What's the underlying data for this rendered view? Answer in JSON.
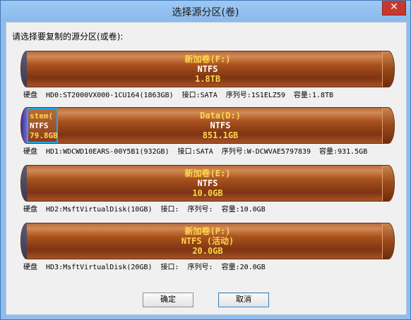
{
  "window": {
    "title": "选择源分区(卷)",
    "close_symbol": "✕"
  },
  "prompt": "请选择要复制的源分区(或卷):",
  "disks": [
    {
      "label": "硬盘",
      "id": "HD0:ST2000VX000-1CU164(1863GB)",
      "interface": "接口:SATA",
      "serial": "序列号:1S1ELZ59",
      "capacity": "容量:1.8TB",
      "partitions": [
        {
          "name": "新加卷(F:)",
          "fs": "NTFS",
          "size": "1.8TB"
        }
      ]
    },
    {
      "label": "硬盘",
      "id": "HD1:WDCWD10EARS-00Y5B1(932GB)",
      "interface": "接口:SATA",
      "serial": "序列号:W-DCWVAE5797839",
      "capacity": "容量:931.5GB",
      "partitions": [
        {
          "name": "stem(",
          "fs": "NTFS",
          "size": "79.8GB"
        },
        {
          "name": "Data(D:)",
          "fs": "NTFS",
          "size": "851.1GB"
        }
      ]
    },
    {
      "label": "硬盘",
      "id": "HD2:MsftVirtualDisk(10GB)",
      "interface": "接口:",
      "serial": "序列号:",
      "capacity": "容量:10.0GB",
      "partitions": [
        {
          "name": "新加卷(E:)",
          "fs": "NTFS",
          "size": "10.0GB"
        }
      ]
    },
    {
      "label": "硬盘",
      "id": "HD3:MsftVirtualDisk(20GB)",
      "interface": "接口:",
      "serial": "序列号:",
      "capacity": "容量:20.0GB",
      "partitions": [
        {
          "name": "新加卷(P:)",
          "fs": "NTFS (活动)",
          "size": "20.0GB"
        }
      ]
    }
  ],
  "buttons": {
    "ok": "确定",
    "cancel": "取消"
  }
}
